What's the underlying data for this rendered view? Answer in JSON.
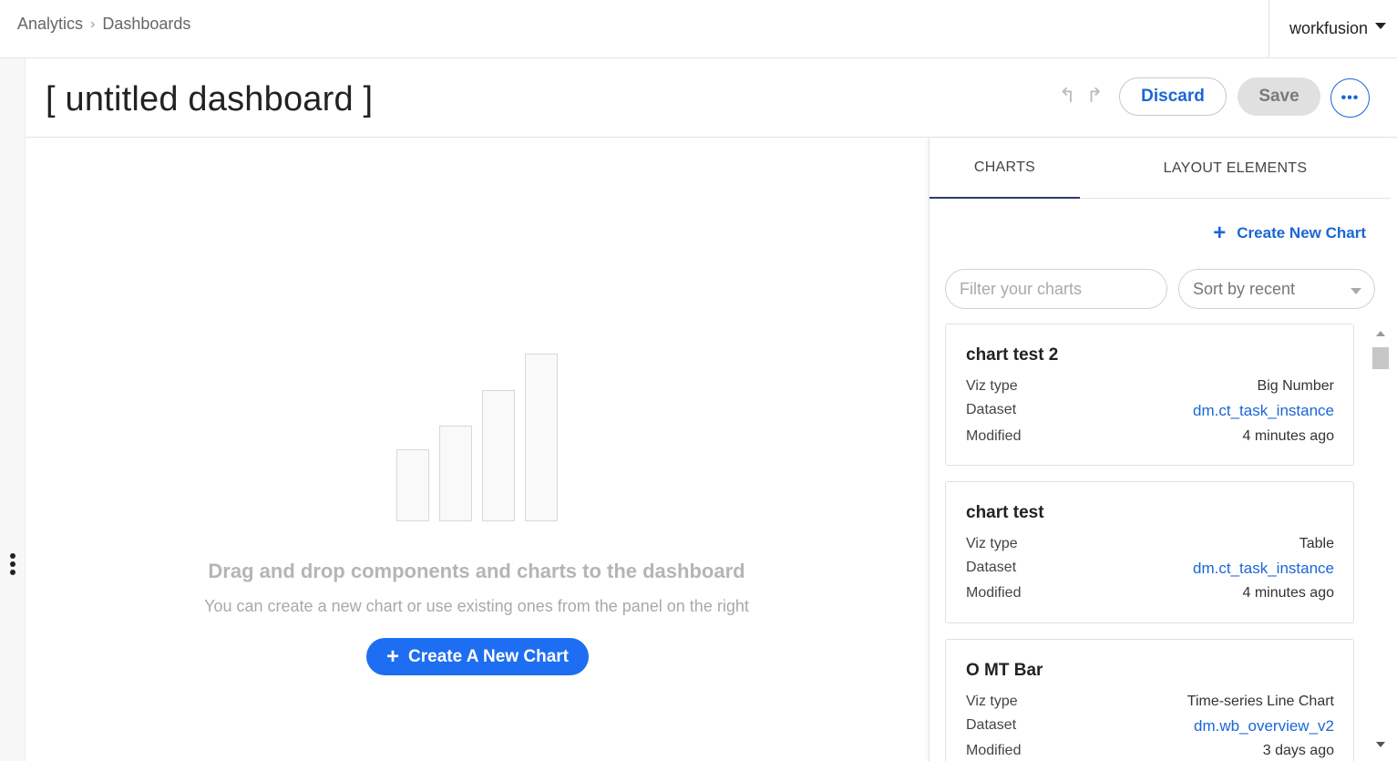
{
  "breadcrumb": {
    "items": [
      "Analytics",
      "Dashboards"
    ],
    "separator": "›"
  },
  "org": {
    "name": "workfusion"
  },
  "header": {
    "title": "[ untitled dashboard ]",
    "undo_icon": "↰",
    "redo_icon": "↱",
    "discard_label": "Discard",
    "save_label": "Save",
    "more_icon": "•••"
  },
  "empty": {
    "title": "Drag and drop components and charts to the dashboard",
    "subtitle": "You can create a new chart or use existing ones from the panel on the right",
    "create_label": "Create A New Chart",
    "plus": "+"
  },
  "panel": {
    "tabs": [
      {
        "label": "CHARTS",
        "active": true
      },
      {
        "label": "LAYOUT ELEMENTS",
        "active": false
      }
    ],
    "create_label": "Create New Chart",
    "plus": "+",
    "filter": {
      "placeholder": "Filter your charts",
      "value": ""
    },
    "sort": {
      "selected": "Sort by recent"
    },
    "labels": {
      "viz": "Viz type",
      "dataset": "Dataset",
      "modified": "Modified"
    },
    "charts": [
      {
        "title": "chart test 2",
        "viz_type": "Big Number",
        "dataset": "dm.ct_task_instance",
        "modified": "4 minutes ago"
      },
      {
        "title": "chart test",
        "viz_type": "Table",
        "dataset": "dm.ct_task_instance",
        "modified": "4 minutes ago"
      },
      {
        "title": "O MT Bar",
        "viz_type": "Time-series Line Chart",
        "dataset": "dm.wb_overview_v2",
        "modified": "3 days ago"
      }
    ]
  },
  "colors": {
    "accent": "#1a66d6",
    "primary_button": "#1d6ef2",
    "tab_indicator": "#2b3a72"
  }
}
